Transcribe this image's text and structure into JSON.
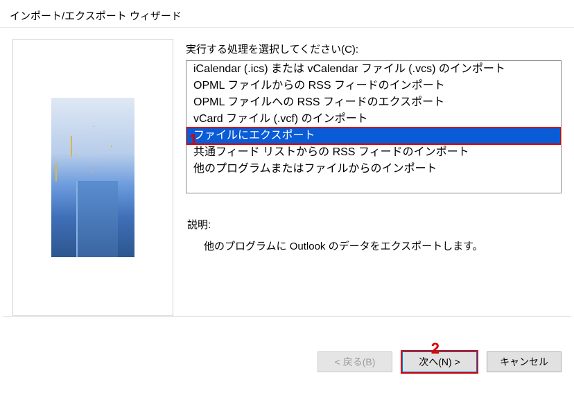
{
  "window": {
    "title": "インポート/エクスポート ウィザード"
  },
  "instruction_label": "実行する処理を選択してください(C):",
  "list_items": {
    "0": "iCalendar (.ics) または vCalendar ファイル (.vcs) のインポート",
    "1": "OPML ファイルからの RSS フィードのインポート",
    "2": "OPML ファイルへの RSS フィードのエクスポート",
    "3": "vCard ファイル (.vcf) のインポート",
    "4": "ファイルにエクスポート",
    "5": "共通フィード リストからの RSS フィードのインポート",
    "6": "他のプログラムまたはファイルからのインポート"
  },
  "description": {
    "label": "説明:",
    "text": "他のプログラムに Outlook のデータをエクスポートします。"
  },
  "buttons": {
    "back": "< 戻る(B)",
    "next": "次へ(N) >",
    "cancel": "キャンセル"
  },
  "annotations": {
    "a1": "1",
    "a2": "2"
  }
}
